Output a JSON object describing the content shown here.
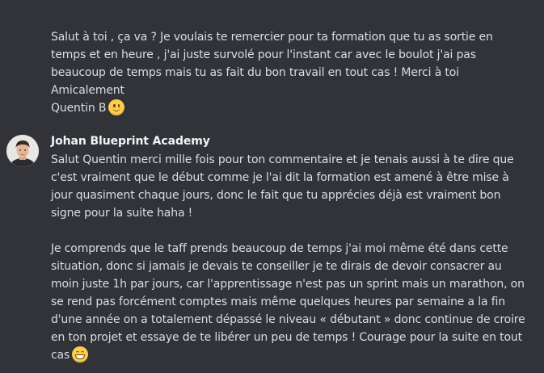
{
  "messages": [
    {
      "author": "",
      "lines": [
        "Salut à toi , ça va ? Je voulais te remercier pour ta formation que tu as sortie en",
        "temps et en heure , j'ai juste survolé pour l'instant car avec le boulot j'ai pas",
        "beaucoup de temps mais tu as fait du bon travail en tout cas ! Merci à toi",
        "Amicalement",
        "Quentin B"
      ],
      "trailing_emoji": "slightly-smiling-face-icon"
    },
    {
      "author": "Johan Blueprint Academy",
      "lines": [
        "Salut Quentin merci mille fois pour ton commentaire et je tenais aussi à te dire que",
        "c'est vraiment que le début comme je l'ai dit la formation est amené à être mise à",
        "jour quasiment chaque jours, donc le fait que tu apprécies déjà est vraiment bon",
        "signe pour la suite haha !",
        "",
        "Je comprends que le taff prends beaucoup de temps j'ai moi même été dans cette",
        "situation, donc si jamais je devais te conseiller je te dirais de devoir consacrer au",
        "moin juste 1h par jours, car l'apprentissage n'est pas un sprint mais un marathon, on",
        "se rend pas forcément comptes mais même quelques heures par semaine a la fin",
        "d'une année on a totalement dépassé le niveau « débutant » donc continue de croire",
        "en ton projet et essaye de te libérer un peu de temps ! Courage pour la suite en tout",
        "cas"
      ],
      "trailing_emoji": "grinning-face-icon"
    }
  ]
}
